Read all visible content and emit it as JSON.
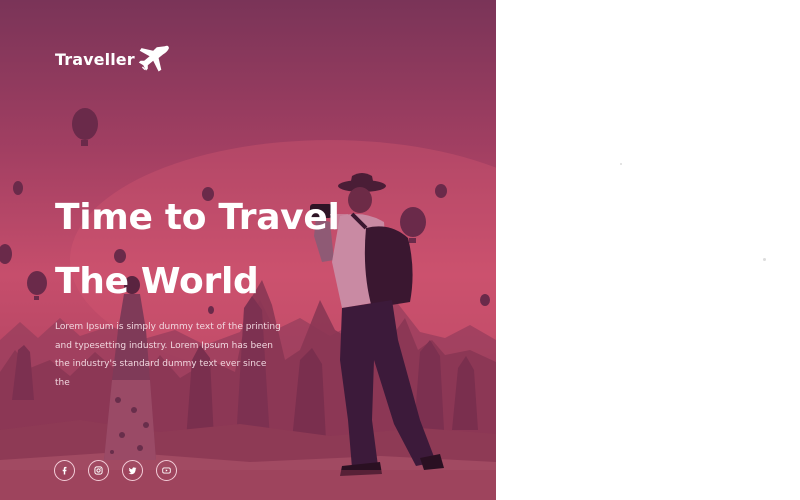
{
  "brand": {
    "name": "Traveller",
    "icon": "airplane-icon"
  },
  "hero": {
    "headline_line1": "Time to Travel",
    "headline_line2": "The World",
    "intro": "Lorem Ipsum is simply dummy text of the printing and typesetting industry. Lorem Ipsum has been the industry's standard dummy text ever since the"
  },
  "socials": [
    {
      "name": "facebook",
      "icon": "facebook-icon"
    },
    {
      "name": "instagram",
      "icon": "instagram-icon"
    },
    {
      "name": "twitter",
      "icon": "twitter-icon"
    },
    {
      "name": "youtube",
      "icon": "youtube-icon"
    }
  ],
  "colors": {
    "overlay_top": "#7a3458",
    "overlay_mid": "#c64e6c",
    "text": "#ffffff",
    "background": "#ffffff"
  }
}
